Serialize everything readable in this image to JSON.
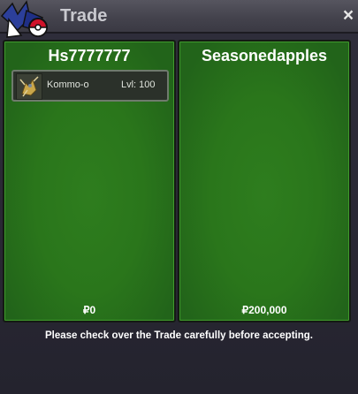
{
  "window": {
    "title": "Trade",
    "close_icon": "×"
  },
  "left_panel": {
    "username": "Hs7777777",
    "pokemon": [
      {
        "name": "Kommo-o",
        "level_text": "Lvl: 100",
        "icon": "kommo-o-sprite-icon"
      }
    ],
    "money": "₽0"
  },
  "right_panel": {
    "username": "Seasonedapples",
    "money": "₽200,000"
  },
  "footer": {
    "message": "Please check over the Trade carefully before accepting."
  },
  "colors": {
    "panel_green": "#2a761b",
    "titlebar": "#4a4953"
  }
}
